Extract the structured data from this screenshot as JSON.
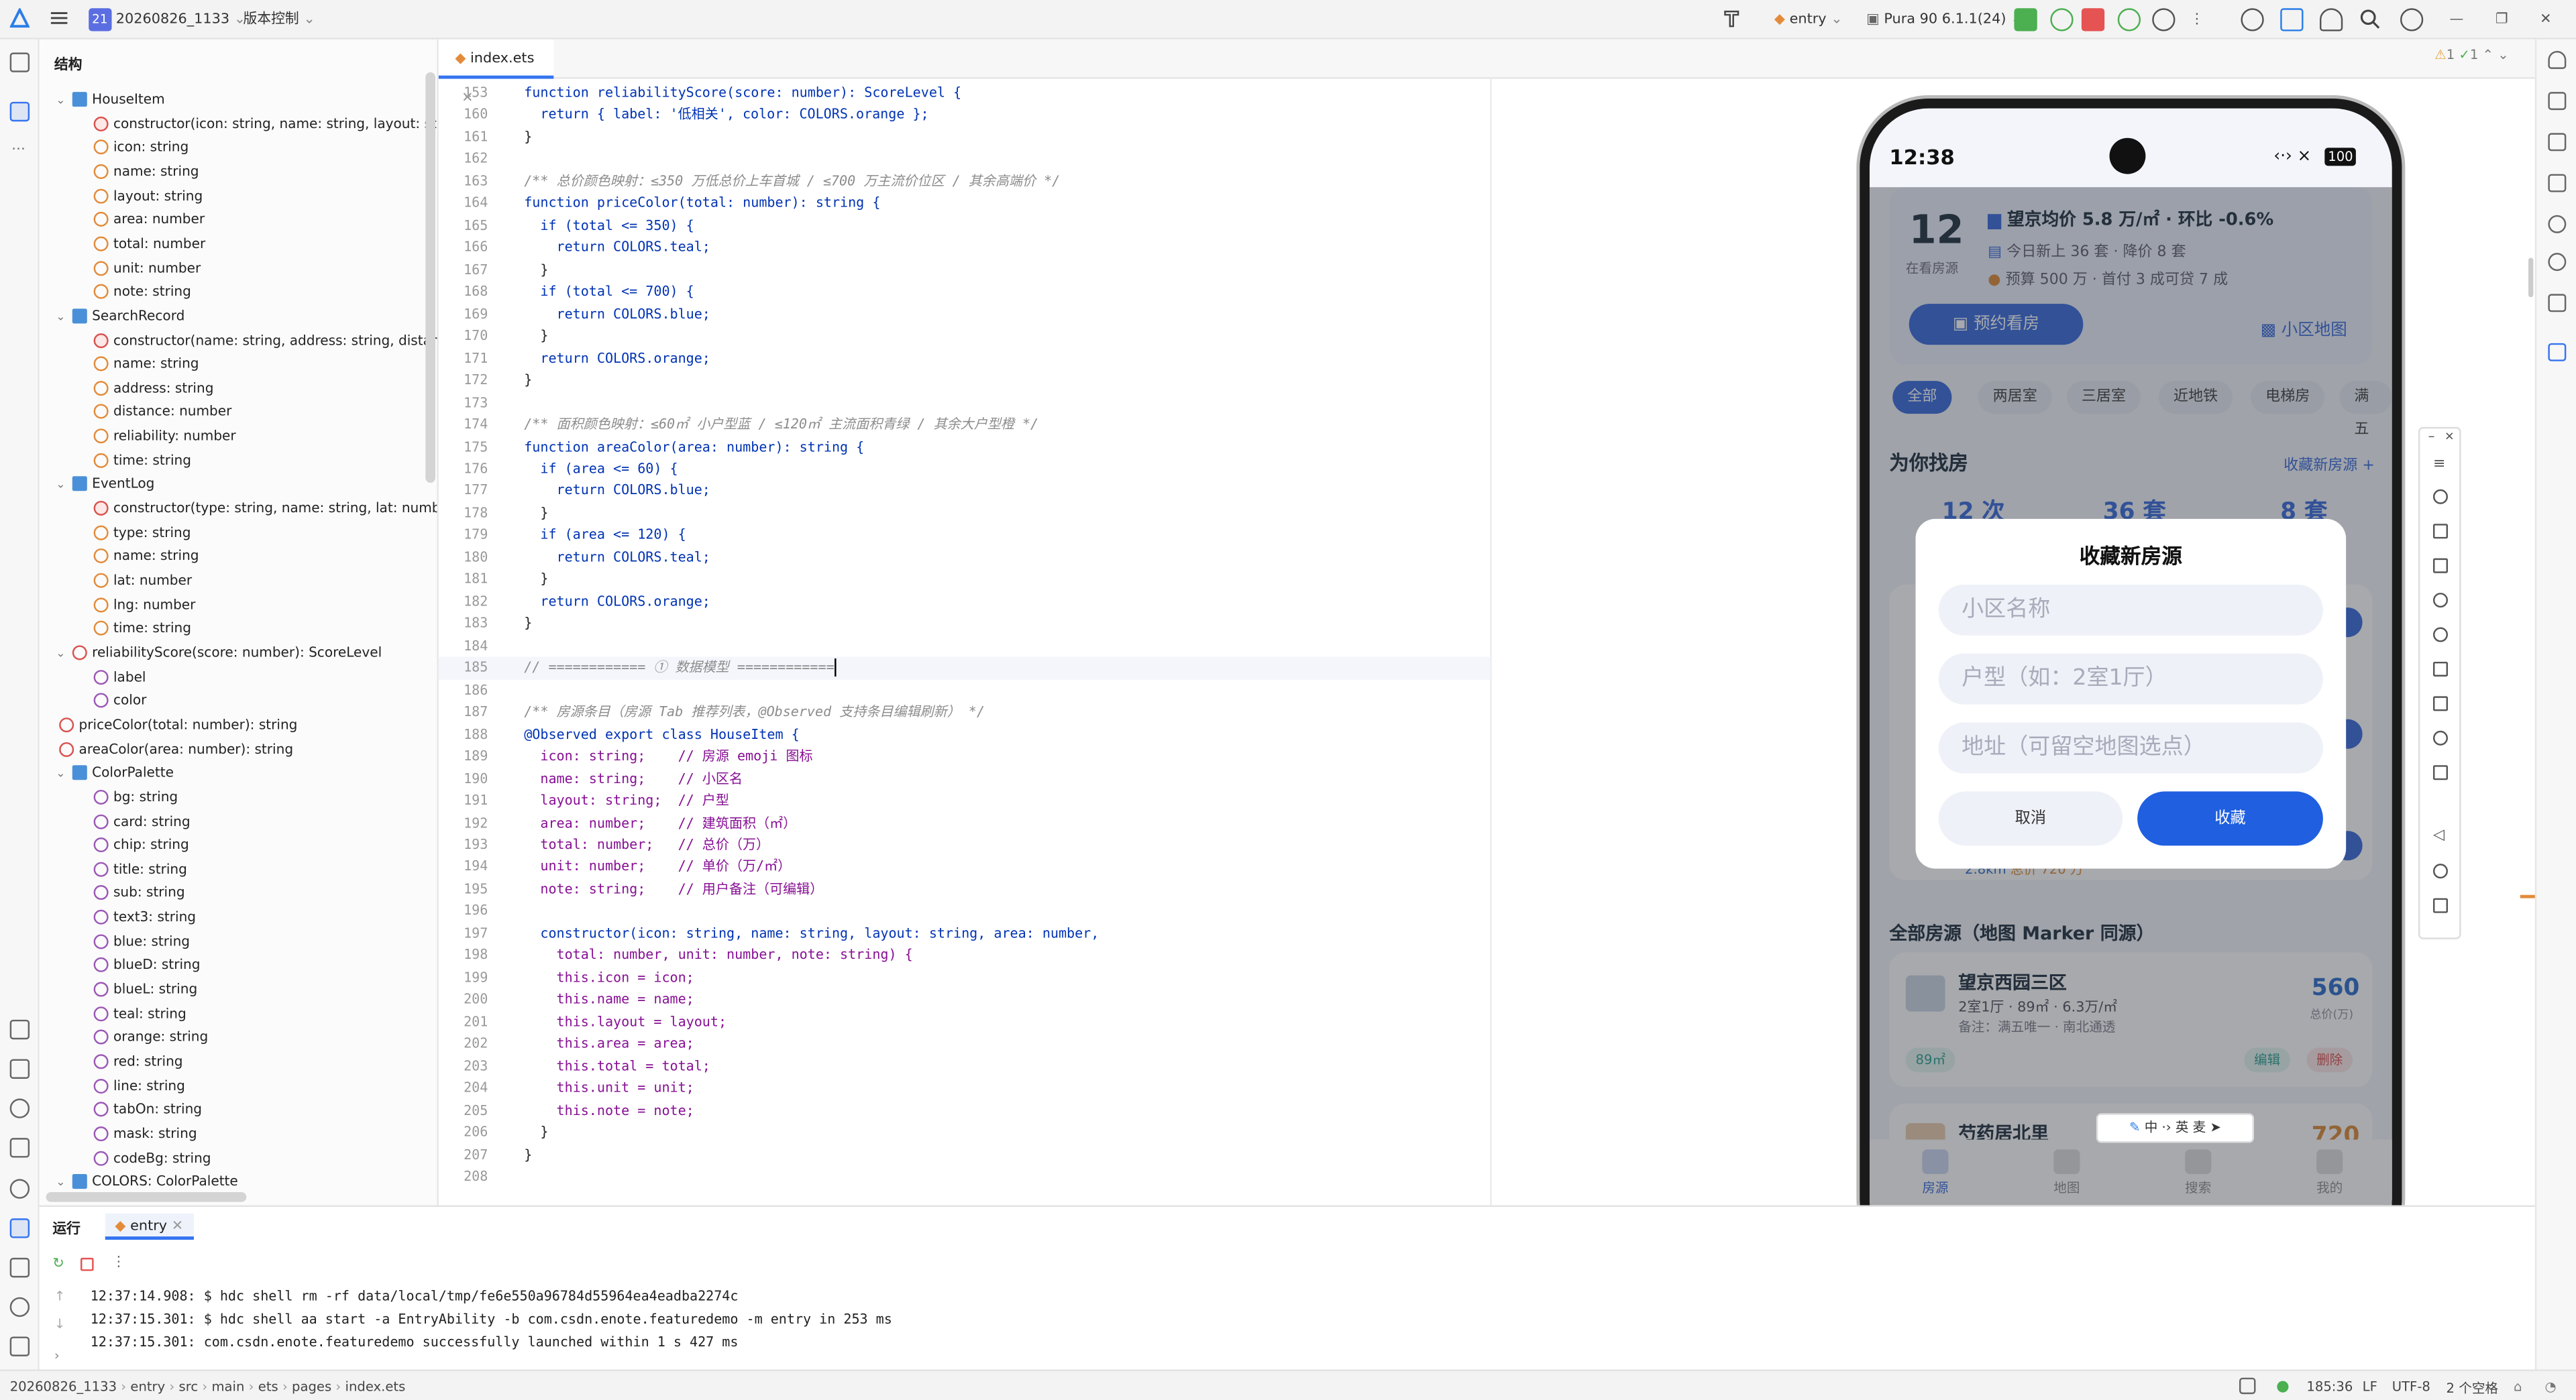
{
  "titlebar": {
    "project_badge": "21",
    "project_name": "20260826_1133",
    "vcs_label": "版本控制",
    "module": "entry",
    "device": "Pura 90 6.1.1(24)"
  },
  "structure": {
    "title": "结构",
    "rows": [
      {
        "label": "HouseItem",
        "kind": "cls",
        "arrow": "⌄",
        "depth": 0
      },
      {
        "label": "constructor(icon: string, name: string, layout: string, ar",
        "kind": "ctor",
        "depth": 1
      },
      {
        "label": "icon: string",
        "kind": "fld",
        "depth": 1
      },
      {
        "label": "name: string",
        "kind": "fld",
        "depth": 1
      },
      {
        "label": "layout: string",
        "kind": "fld",
        "depth": 1
      },
      {
        "label": "area: number",
        "kind": "fld",
        "depth": 1
      },
      {
        "label": "total: number",
        "kind": "fld",
        "depth": 1
      },
      {
        "label": "unit: number",
        "kind": "fld",
        "depth": 1
      },
      {
        "label": "note: string",
        "kind": "fld",
        "depth": 1
      },
      {
        "label": "SearchRecord",
        "kind": "cls",
        "arrow": "⌄",
        "depth": 0
      },
      {
        "label": "constructor(name: string, address: string, distance: nu",
        "kind": "ctor",
        "depth": 1
      },
      {
        "label": "name: string",
        "kind": "fld",
        "depth": 1
      },
      {
        "label": "address: string",
        "kind": "fld",
        "depth": 1
      },
      {
        "label": "distance: number",
        "kind": "fld",
        "depth": 1
      },
      {
        "label": "reliability: number",
        "kind": "fld",
        "depth": 1
      },
      {
        "label": "time: string",
        "kind": "fld",
        "depth": 1
      },
      {
        "label": "EventLog",
        "kind": "cls",
        "arrow": "⌄",
        "depth": 0
      },
      {
        "label": "constructor(type: string, name: string, lat: number, lng",
        "kind": "ctor",
        "depth": 1
      },
      {
        "label": "type: string",
        "kind": "fld",
        "depth": 1
      },
      {
        "label": "name: string",
        "kind": "fld",
        "depth": 1
      },
      {
        "label": "lat: number",
        "kind": "fld",
        "depth": 1
      },
      {
        "label": "lng: number",
        "kind": "fld",
        "depth": 1
      },
      {
        "label": "time: string",
        "kind": "fld",
        "depth": 1
      },
      {
        "label": "reliabilityScore(score: number): ScoreLevel",
        "kind": "fn",
        "arrow": "⌄",
        "depth": 0
      },
      {
        "label": "label",
        "kind": "prop",
        "depth": 1
      },
      {
        "label": "color",
        "kind": "prop",
        "depth": 1
      },
      {
        "label": "priceColor(total: number): string",
        "kind": "fn",
        "depth": 0
      },
      {
        "label": "areaColor(area: number): string",
        "kind": "fn",
        "depth": 0
      },
      {
        "label": "ColorPalette",
        "kind": "cls",
        "arrow": "⌄",
        "depth": 0
      },
      {
        "label": "bg: string",
        "kind": "prop",
        "depth": 1
      },
      {
        "label": "card: string",
        "kind": "prop",
        "depth": 1
      },
      {
        "label": "chip: string",
        "kind": "prop",
        "depth": 1
      },
      {
        "label": "title: string",
        "kind": "prop",
        "depth": 1
      },
      {
        "label": "sub: string",
        "kind": "prop",
        "depth": 1
      },
      {
        "label": "text3: string",
        "kind": "prop",
        "depth": 1
      },
      {
        "label": "blue: string",
        "kind": "prop",
        "depth": 1
      },
      {
        "label": "blueD: string",
        "kind": "prop",
        "depth": 1
      },
      {
        "label": "blueL: string",
        "kind": "prop",
        "depth": 1
      },
      {
        "label": "teal: string",
        "kind": "prop",
        "depth": 1
      },
      {
        "label": "orange: string",
        "kind": "prop",
        "depth": 1
      },
      {
        "label": "red: string",
        "kind": "prop",
        "depth": 1
      },
      {
        "label": "line: string",
        "kind": "prop",
        "depth": 1
      },
      {
        "label": "tabOn: string",
        "kind": "prop",
        "depth": 1
      },
      {
        "label": "mask: string",
        "kind": "prop",
        "depth": 1
      },
      {
        "label": "codeBg: string",
        "kind": "prop",
        "depth": 1
      },
      {
        "label": "COLORS: ColorPalette",
        "kind": "cls",
        "arrow": "⌄",
        "depth": 0
      }
    ]
  },
  "editor": {
    "tab": "index.ets",
    "cursor_line": 185,
    "lines": [
      {
        "n": 153,
        "t": "function reliabilityScore(score: number): ScoreLevel {"
      },
      {
        "n": 160,
        "t": "  return { label: '低相关', color: COLORS.orange };"
      },
      {
        "n": 161,
        "t": "}"
      },
      {
        "n": 162,
        "t": ""
      },
      {
        "n": 163,
        "t": "/** 总价颜色映射：≤350 万低总价上车首城 / ≤700 万主流价位区 / 其余高端价 */"
      },
      {
        "n": 164,
        "t": "function priceColor(total: number): string {"
      },
      {
        "n": 165,
        "t": "  if (total <= 350) {"
      },
      {
        "n": 166,
        "t": "    return COLORS.teal;"
      },
      {
        "n": 167,
        "t": "  }"
      },
      {
        "n": 168,
        "t": "  if (total <= 700) {"
      },
      {
        "n": 169,
        "t": "    return COLORS.blue;"
      },
      {
        "n": 170,
        "t": "  }"
      },
      {
        "n": 171,
        "t": "  return COLORS.orange;"
      },
      {
        "n": 172,
        "t": "}"
      },
      {
        "n": 173,
        "t": ""
      },
      {
        "n": 174,
        "t": "/** 面积颜色映射：≤60㎡ 小户型蓝 / ≤120㎡ 主流面积青绿 / 其余大户型橙 */"
      },
      {
        "n": 175,
        "t": "function areaColor(area: number): string {"
      },
      {
        "n": 176,
        "t": "  if (area <= 60) {"
      },
      {
        "n": 177,
        "t": "    return COLORS.blue;"
      },
      {
        "n": 178,
        "t": "  }"
      },
      {
        "n": 179,
        "t": "  if (area <= 120) {"
      },
      {
        "n": 180,
        "t": "    return COLORS.teal;"
      },
      {
        "n": 181,
        "t": "  }"
      },
      {
        "n": 182,
        "t": "  return COLORS.orange;"
      },
      {
        "n": 183,
        "t": "}"
      },
      {
        "n": 184,
        "t": ""
      },
      {
        "n": 185,
        "t": "// ============ ① 数据模型 ============"
      },
      {
        "n": 186,
        "t": ""
      },
      {
        "n": 187,
        "t": "/** 房源条目（房源 Tab 推荐列表，@Observed 支持条目编辑刷新） */"
      },
      {
        "n": 188,
        "t": "@Observed export class HouseItem {"
      },
      {
        "n": 189,
        "t": "  icon: string;    // 房源 emoji 图标"
      },
      {
        "n": 190,
        "t": "  name: string;    // 小区名"
      },
      {
        "n": 191,
        "t": "  layout: string;  // 户型"
      },
      {
        "n": 192,
        "t": "  area: number;    // 建筑面积（㎡）"
      },
      {
        "n": 193,
        "t": "  total: number;   // 总价（万）"
      },
      {
        "n": 194,
        "t": "  unit: number;    // 单价（万/㎡）"
      },
      {
        "n": 195,
        "t": "  note: string;    // 用户备注（可编辑）"
      },
      {
        "n": 196,
        "t": ""
      },
      {
        "n": 197,
        "t": "  constructor(icon: string, name: string, layout: string, area: number,"
      },
      {
        "n": 198,
        "t": "    total: number, unit: number, note: string) {"
      },
      {
        "n": 199,
        "t": "    this.icon = icon;"
      },
      {
        "n": 200,
        "t": "    this.name = name;"
      },
      {
        "n": 201,
        "t": "    this.layout = layout;"
      },
      {
        "n": 202,
        "t": "    this.area = area;"
      },
      {
        "n": 203,
        "t": "    this.total = total;"
      },
      {
        "n": 204,
        "t": "    this.unit = unit;"
      },
      {
        "n": 205,
        "t": "    this.note = note;"
      },
      {
        "n": 206,
        "t": "  }"
      },
      {
        "n": 207,
        "t": "}"
      },
      {
        "n": 208,
        "t": ""
      }
    ],
    "inspections": {
      "warnings": "1",
      "weak": "1"
    }
  },
  "phone": {
    "time": "12:38",
    "battery": "100",
    "header": {
      "count": "12",
      "count_label": "在看房源",
      "line1": "望京均价 5.8 万/㎡ · 环比 -0.6%",
      "line2": "今日新上 36 套 · 降价 8 套",
      "line3": "预算 500 万 · 首付 3 成可贷 7 成",
      "book_button": "预约看房",
      "map_link": "小区地图"
    },
    "filters": [
      "全部",
      "两居室",
      "三居室",
      "近地铁",
      "电梯房",
      "满五"
    ],
    "section1": "为你找房",
    "section1_link": "收藏新房源 +",
    "stats": [
      "12 次",
      "36 套",
      "8 套"
    ],
    "partial_row": {
      "dist": "2.8km",
      "price": "总价 720 万"
    },
    "section2": "全部房源（地图 Marker 同源）",
    "card1": {
      "name": "望京西园三区",
      "detail": "2室1厅 · 89㎡ · 6.3万/㎡",
      "note": "备注：满五唯一 · 南北通透",
      "price": "560",
      "price_unit": "总价(万)",
      "tag": "89㎡",
      "edit": "编辑",
      "delete": "删除"
    },
    "card2": {
      "name": "芍药居北里",
      "price": "720"
    },
    "ime_keys": [
      "中",
      "英",
      "麦"
    ],
    "dialog": {
      "title": "收藏新房源",
      "ph1": "小区名称",
      "ph2": "户型（如：2室1厅）",
      "ph3": "地址（可留空地图选点）",
      "cancel": "取消",
      "confirm": "收藏"
    },
    "nav": [
      "房源",
      "地图",
      "搜索",
      "我的"
    ]
  },
  "run": {
    "label": "运行",
    "tab": "entry",
    "logs": [
      "12:37:14.908: $ hdc shell rm -rf data/local/tmp/fe6e550a96784d55964ea4eadba2274c",
      "12:37:15.301: $ hdc shell aa start -a EntryAbility -b com.csdn.enote.featuredemo -m entry in 253 ms",
      "12:37:15.301: com.csdn.enote.featuredemo successfully launched within 1 s 427 ms"
    ]
  },
  "status": {
    "crumbs": [
      "20260826_1133",
      "entry",
      "src",
      "main",
      "ets",
      "pages",
      "index.ets"
    ],
    "position": "185:36",
    "eol": "LF",
    "encoding": "UTF-8",
    "indent": "2 个空格"
  },
  "colors": {
    "accent": "#3574f0",
    "phone_primary": "#2b5fd9",
    "price_blue": "#1e63c9",
    "price_orange": "#d9822b",
    "teal": "#1e9c8a"
  }
}
